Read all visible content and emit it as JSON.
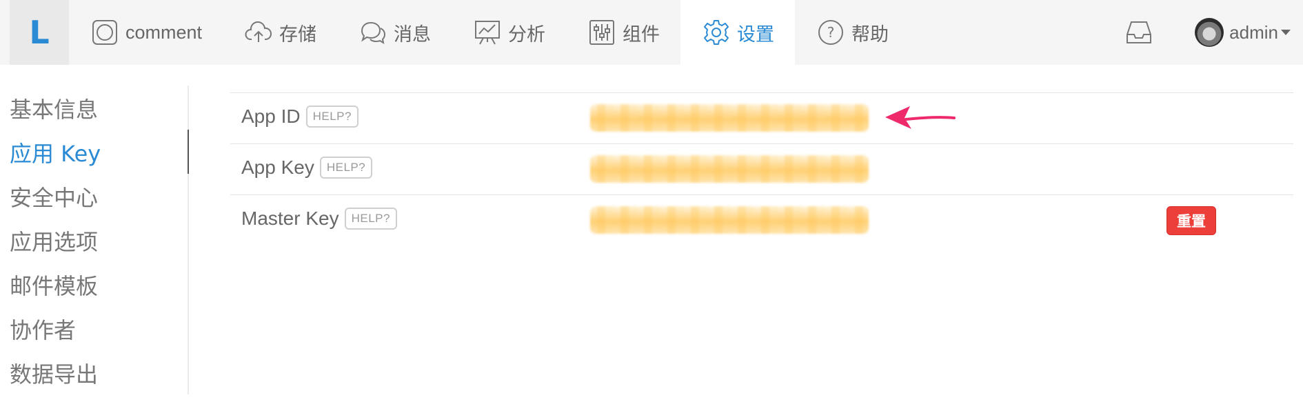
{
  "brand": {
    "logo_letter": "L",
    "accent_color": "#2a8ad4"
  },
  "nav": {
    "items": [
      {
        "label": "comment",
        "icon": "app-square-icon"
      },
      {
        "label": "存储",
        "icon": "cloud-upload-icon"
      },
      {
        "label": "消息",
        "icon": "chat-bubbles-icon"
      },
      {
        "label": "分析",
        "icon": "chart-board-icon"
      },
      {
        "label": "组件",
        "icon": "sliders-icon"
      },
      {
        "label": "设置",
        "icon": "gear-icon",
        "active": true
      },
      {
        "label": "帮助",
        "icon": "help-circle-icon"
      }
    ],
    "user": {
      "name": "admin"
    }
  },
  "sidebar": {
    "items": [
      {
        "label": "基本信息"
      },
      {
        "label": "应用 Key",
        "active": true
      },
      {
        "label": "安全中心"
      },
      {
        "label": "应用选项"
      },
      {
        "label": "邮件模板"
      },
      {
        "label": "协作者"
      },
      {
        "label": "数据导出"
      }
    ]
  },
  "keys": {
    "rows": [
      {
        "label": "App ID",
        "help": "HELP?"
      },
      {
        "label": "App Key",
        "help": "HELP?"
      },
      {
        "label": "Master Key",
        "help": "HELP?",
        "action": "重置"
      }
    ]
  },
  "colors": {
    "reset_button": "#ec3f3a",
    "annotation_arrow": "#ee2a6a"
  }
}
